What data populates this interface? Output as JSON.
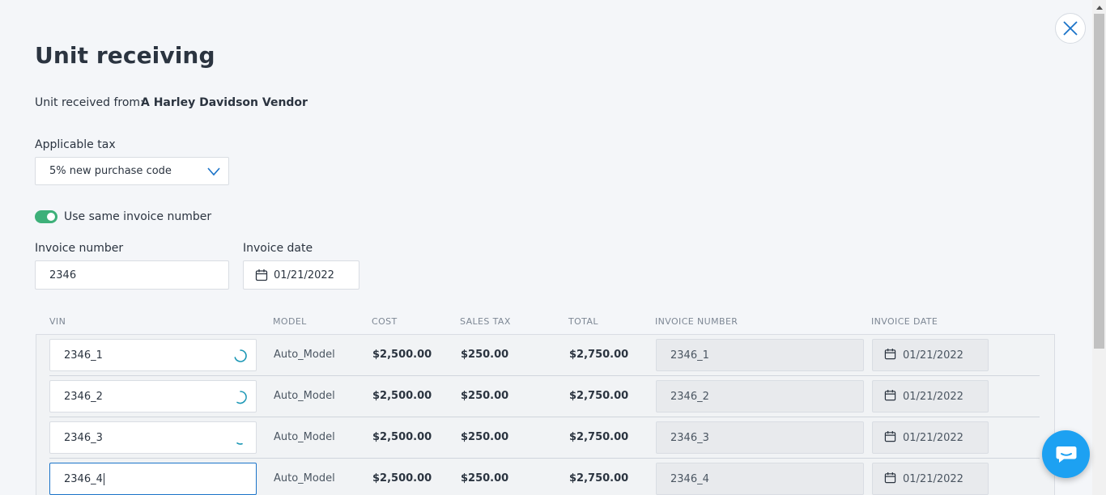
{
  "modal": {
    "title": "Unit receiving",
    "received_from_label": "Unit received from:",
    "received_from_value": "A Harley Davidson Vendor"
  },
  "tax": {
    "label": "Applicable tax",
    "selected": "5% new purchase code"
  },
  "toggle": {
    "label": "Use same invoice number",
    "on": true
  },
  "invoice": {
    "number_label": "Invoice number",
    "number_value": "2346",
    "date_label": "Invoice date",
    "date_value": "01/21/2022"
  },
  "table": {
    "headers": {
      "vin": "VIN",
      "model": "MODEL",
      "cost": "COST",
      "sales_tax": "SALES TAX",
      "total": "TOTAL",
      "invoice_number": "INVOICE NUMBER",
      "invoice_date": "INVOICE DATE"
    },
    "rows": [
      {
        "vin": "2346_1",
        "model": "Auto_Model",
        "cost": "$2,500.00",
        "sales_tax": "$250.00",
        "total": "$2,750.00",
        "invoice_number": "2346_1",
        "invoice_date": "01/21/2022"
      },
      {
        "vin": "2346_2",
        "model": "Auto_Model",
        "cost": "$2,500.00",
        "sales_tax": "$250.00",
        "total": "$2,750.00",
        "invoice_number": "2346_2",
        "invoice_date": "01/21/2022"
      },
      {
        "vin": "2346_3",
        "model": "Auto_Model",
        "cost": "$2,500.00",
        "sales_tax": "$250.00",
        "total": "$2,750.00",
        "invoice_number": "2346_3",
        "invoice_date": "01/21/2022"
      },
      {
        "vin": "2346_4",
        "model": "Auto_Model",
        "cost": "$2,500.00",
        "sales_tax": "$250.00",
        "total": "$2,750.00",
        "invoice_number": "2346_4",
        "invoice_date": "01/21/2022"
      }
    ]
  },
  "icons": {
    "close": "close-icon",
    "chevron": "chevron-down-icon",
    "calendar": "calendar-icon",
    "spinner": "loading-spinner-icon",
    "chat": "chat-icon"
  },
  "colors": {
    "accent": "#1a73c8",
    "toggle_on": "#3db079",
    "chat": "#1da1f2"
  }
}
